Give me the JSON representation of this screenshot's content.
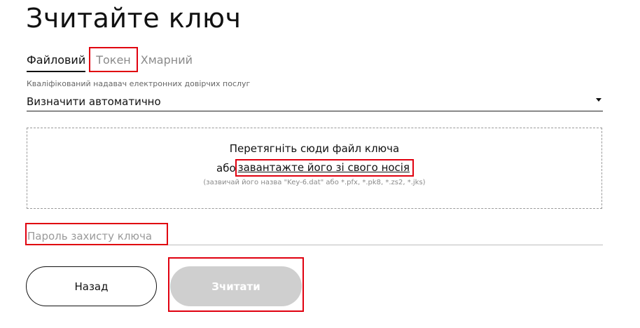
{
  "page": {
    "title": "Зчитайте ключ"
  },
  "tabs": [
    {
      "label": "Файловий",
      "active": true
    },
    {
      "label": "Токен",
      "active": false,
      "highlighted": true
    },
    {
      "label": "Хмарний",
      "active": false
    }
  ],
  "provider": {
    "label": "Кваліфікований надавач електронних довірчих послуг",
    "selected": "Визначити автоматично",
    "icon": "dropdown-arrow-icon"
  },
  "dropzone": {
    "line1": "Перетягніть сюди файл ключа",
    "prefix": "або",
    "link": "завантажте його зі свого носія",
    "hint": "(зазвичай його назва \"Key-6.dat\" або *.pfx, *.pk8, *.zs2, *.jks)"
  },
  "password": {
    "placeholder": "Пароль захисту ключа",
    "value": ""
  },
  "buttons": {
    "back": "Назад",
    "read": "Зчитати"
  },
  "colors": {
    "highlight": "#e0000f",
    "disabled_button": "#cfcfcf"
  }
}
